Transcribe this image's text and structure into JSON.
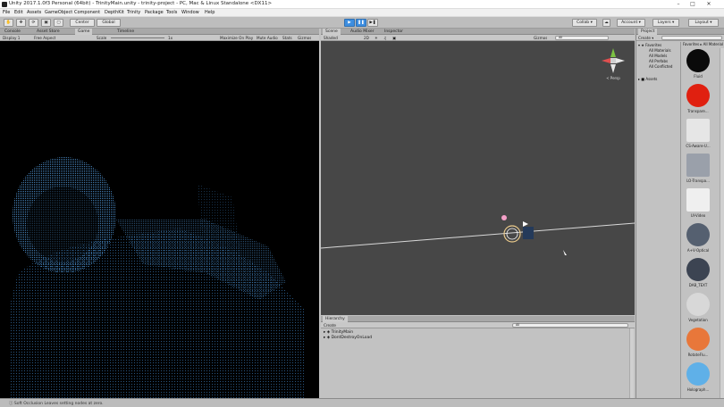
{
  "window": {
    "title": "Unity 2017.1.0f3 Personal (64bit) - TrinityMain.unity - trinity-project - PC, Mac & Linux Standalone <DX11>",
    "min": "–",
    "max": "□",
    "close": "✕"
  },
  "menu": [
    "File",
    "Edit",
    "Assets",
    "GameObject",
    "Component",
    "DepthKit",
    "Trinity",
    "Package",
    "Tools",
    "Window",
    "Help"
  ],
  "toolbar": {
    "pivot": "Center",
    "space": "Global",
    "collab": "Collab ▾",
    "account": "Account ▾",
    "layers": "Layers ▾",
    "layout": "Layout ▾"
  },
  "left_panel": {
    "tabs": [
      "Console",
      "Asset Store",
      "Game",
      "Timeline"
    ],
    "display": "Display 1",
    "aspect": "Free Aspect",
    "scale_label": "Scale",
    "scale_value": "1x",
    "options": [
      "Maximize On Play",
      "Mute Audio",
      "Stats",
      "Gizmos"
    ]
  },
  "scene_panel": {
    "tabs": [
      "Scene",
      "Audio Mixer",
      "Inspector"
    ],
    "shading": "Shaded",
    "mode": "2D",
    "gizmos": "Gizmos",
    "search": "All",
    "persp": "< Persp"
  },
  "hierarchy": {
    "tab": "Hierarchy",
    "create": "Create",
    "search": "All",
    "rows": [
      "▸ ◈ TrinityMain",
      "▸ ◈ DontDestroyOnLoad"
    ]
  },
  "project": {
    "tab": "Project",
    "create": "Create ▾",
    "tree": [
      "▾ ★ Favorites",
      "All Materials",
      "All Models",
      "All Prefabs",
      "All Conflicted",
      "▸ ■ Assets"
    ],
    "breadcrumb": [
      "Favorites",
      "All Material"
    ],
    "assets": [
      {
        "name": "Fluid",
        "color": "#0a0a0a"
      },
      {
        "name": "Transpare...",
        "color": "#e02010"
      },
      {
        "name": "CS-Aware-U...",
        "color": "#e6e6e6"
      },
      {
        "name": "LO-Transpa...",
        "color": "#9aa0aa"
      },
      {
        "name": "UI-Video",
        "color": "#efefef"
      },
      {
        "name": "A+V-Optical",
        "color": "#556070"
      },
      {
        "name": "DAB_TEXT",
        "color": "#3c4452"
      },
      {
        "name": "Vegetation",
        "color": "#d8d8d8"
      },
      {
        "name": "RotateFlu...",
        "color": "#e8773a"
      },
      {
        "name": "Holograph...",
        "color": "#5fb0e8"
      }
    ]
  },
  "status": {
    "text": "ⓘ Soft Occlusion Leaves setting nodes at zero."
  },
  "colors": {
    "accent": "#3d8ee0",
    "scene_bg": "#474747",
    "point_cloud": "#4a8cc8"
  }
}
